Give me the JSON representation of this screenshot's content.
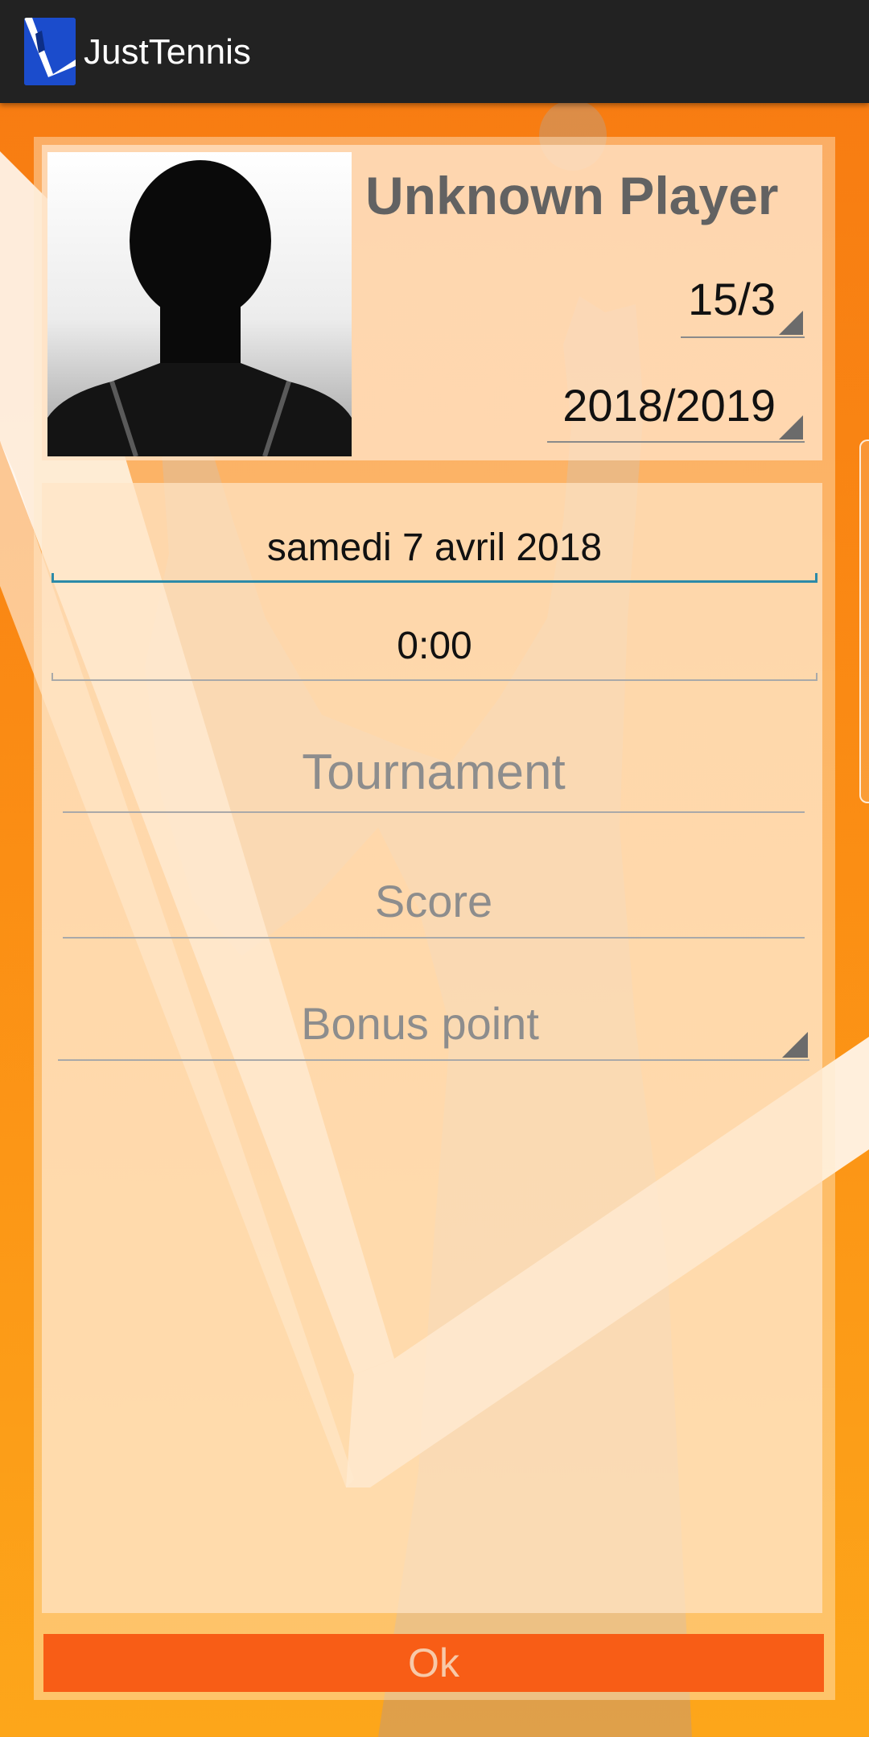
{
  "app": {
    "title": "JustTennis"
  },
  "player": {
    "name": "Unknown Player",
    "ranking": "15/3",
    "season": "2018/2019"
  },
  "form": {
    "date": "samedi 7 avril 2018",
    "time": "0:00",
    "tournament_placeholder": "Tournament",
    "score_placeholder": "Score",
    "bonus_placeholder": "Bonus point"
  },
  "actions": {
    "ok_label": "Ok"
  },
  "colors": {
    "appbar": "#222222",
    "background": "#f77a12",
    "accent_underline": "#2c8aa8",
    "ok_button": "#f85d16",
    "ok_text": "#f7c9a8"
  },
  "icons": {
    "app_logo": "app-logo-icon",
    "dropdown": "dropdown-triangle-icon"
  }
}
